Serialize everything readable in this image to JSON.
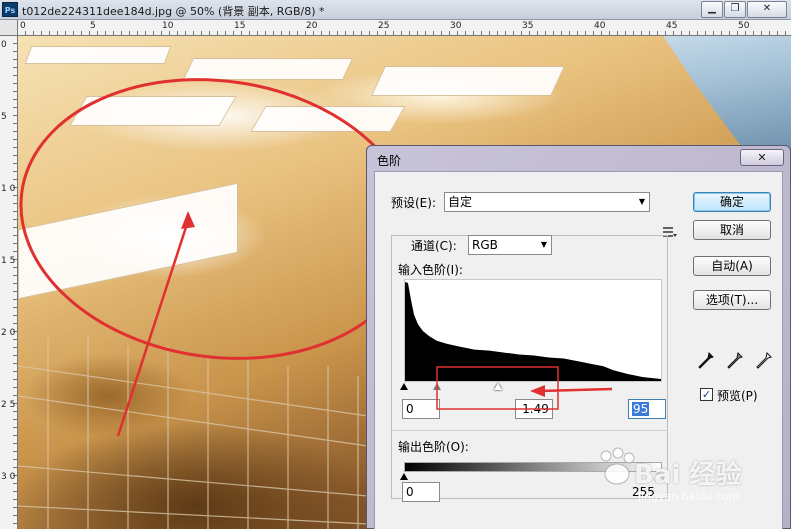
{
  "document": {
    "title": "t012de224311dee184d.jpg @ 50% (背景 副本, RGB/8) *",
    "app_icon": "Ps",
    "window_buttons": {
      "minimize": "▁",
      "restore": "❐",
      "close": "✕"
    }
  },
  "rulers": {
    "top_labels": [
      "0",
      "5",
      "10",
      "15",
      "20",
      "25",
      "30",
      "35",
      "40",
      "45",
      "50"
    ],
    "left_labels": [
      "0",
      "5",
      "1 0",
      "1 5",
      "2 0",
      "2 5",
      "3 0"
    ]
  },
  "levels_dialog": {
    "title": "色阶",
    "close_label": "✕",
    "preset_label": "预设(E):",
    "preset_value": "自定",
    "channel_label": "通道(C):",
    "channel_value": "RGB",
    "input_levels_label": "输入色阶(I):",
    "input_black": "0",
    "input_gamma": "1.49",
    "input_white": "95",
    "output_levels_label": "输出色阶(O):",
    "output_black": "0",
    "output_white": "255",
    "buttons": {
      "ok": "确定",
      "cancel": "取消",
      "auto": "自动(A)",
      "options": "选项(T)..."
    },
    "preview_label": "预览(P)",
    "preview_checked": true,
    "icons": [
      "histogram-menu-icon",
      "black-eyedropper-icon",
      "gray-eyedropper-icon",
      "white-eyedropper-icon"
    ]
  },
  "watermark": {
    "text": "Bai 经验",
    "url": "jingyan.baidu.com"
  },
  "colors": {
    "annotation_red": "#e03030",
    "dialog_frame": "#bcb6cc",
    "accent_blue": "#3c7fb1"
  }
}
